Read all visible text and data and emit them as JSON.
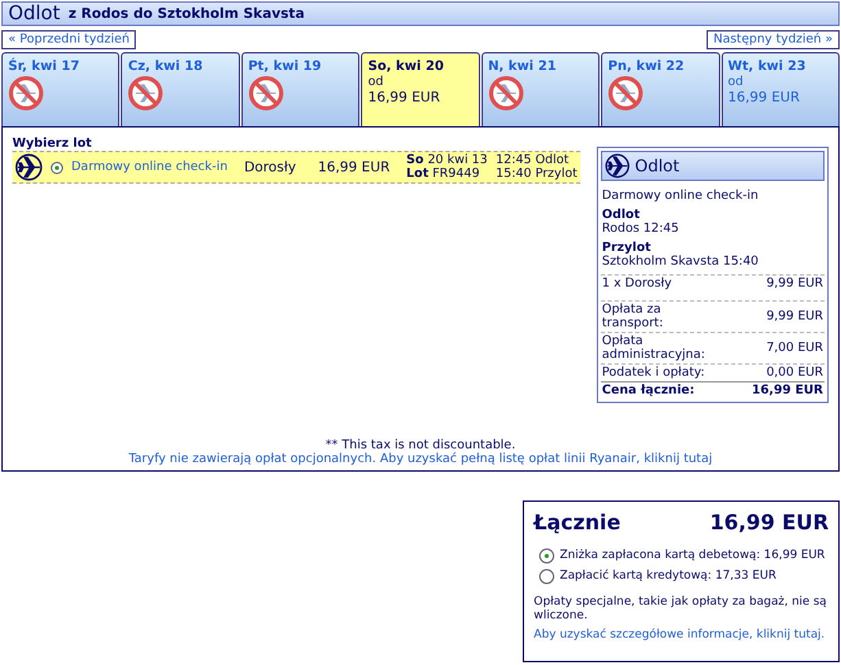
{
  "header": {
    "title": "Odlot",
    "route": "z Rodos do Sztokholm Skavsta"
  },
  "week_nav": {
    "previous": "« Poprzedni tydzień",
    "next": "Następny tydzień »"
  },
  "days": [
    {
      "label": "Śr, kwi 17",
      "available": false,
      "selected": false
    },
    {
      "label": "Cz, kwi 18",
      "available": false,
      "selected": false
    },
    {
      "label": "Pt, kwi 19",
      "available": false,
      "selected": false
    },
    {
      "label": "So, kwi 20",
      "available": true,
      "selected": true,
      "from": "od",
      "price": "16,99 EUR"
    },
    {
      "label": "N, kwi 21",
      "available": false,
      "selected": false
    },
    {
      "label": "Pn, kwi 22",
      "available": false,
      "selected": false
    },
    {
      "label": "Wt, kwi 23",
      "available": true,
      "selected": false,
      "from": "od",
      "price": "16,99 EUR"
    }
  ],
  "flights": {
    "heading": "Wybierz lot",
    "rows": [
      {
        "selected": true,
        "fare": "Darmowy online check-in",
        "passenger": "Dorosły",
        "price": "16,99 EUR",
        "date": "**So** 20 kwi 13",
        "flight": "**Lot** FR9449",
        "departure": "12:45 Odlot",
        "arrival": "15:40 Przylot"
      }
    ]
  },
  "summary": {
    "title": "Odlot",
    "fare": "Darmowy online check-in",
    "departure_label": "Odlot",
    "departure": "Rodos 12:45",
    "arrival_label": "Przylot",
    "arrival": "Sztokholm Skavsta 15:40",
    "passengers": [
      {
        "label": "1 x Dorosły",
        "value": "9,99 EUR"
      }
    ],
    "fees": [
      {
        "label": "Opłata za transport:",
        "value": "9,99 EUR"
      },
      {
        "label": "Opłata administracyjna:",
        "value": "7,00 EUR"
      },
      {
        "label": "Podatek i opłaty:",
        "value": "0,00 EUR"
      }
    ],
    "total_label": "Cena łącznie:",
    "total": "16,99 EUR"
  },
  "footnote": "** This tax is not discountable.",
  "fees_link": "Taryfy nie zawierają opłat opcjonalnych. Aby uzyskać pełną listę opłat linii Ryanair, kliknij tutaj",
  "total_box": {
    "title": "Łącznie",
    "amount": "16,99 EUR",
    "options": [
      {
        "label": "Zniżka zapłacona kartą debetową: 16,99 EUR",
        "selected": true
      },
      {
        "label": "Zapłacić kartą kredytową: 17,33 EUR",
        "selected": false
      }
    ],
    "note": "Opłaty specjalne, takie jak opłaty za bagaż, nie są wliczone.",
    "note_link": "Aby uzyskać szczegółowe informacje, kliknij tutaj."
  }
}
